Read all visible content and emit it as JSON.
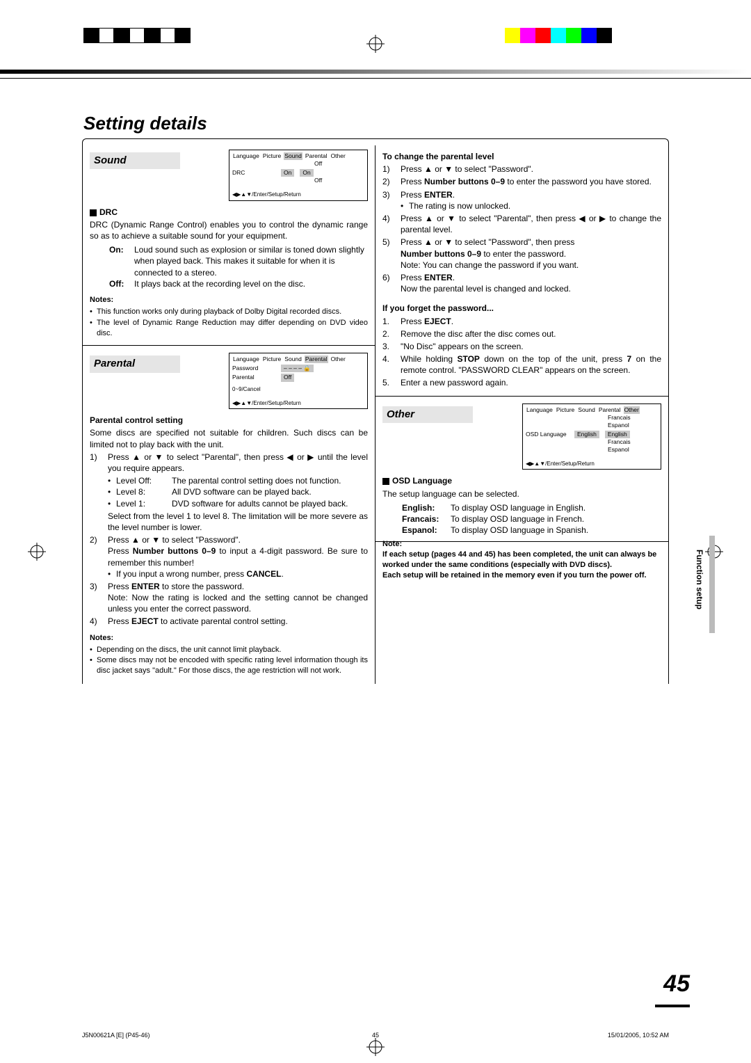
{
  "meta": {
    "page_title": "Setting details",
    "side_label": "Function setup",
    "page_number": "45",
    "footer_left": "J5N00621A [E] (P45-46)",
    "footer_mid": "45",
    "footer_right": "15/01/2005, 10:52 AM"
  },
  "registration": {
    "colorbar_left": [
      "#000000",
      "#ffffff",
      "#000000",
      "#ffffff",
      "#000000",
      "#ffffff",
      "#000000"
    ],
    "colorbar_right": [
      "#ffffff",
      "#ffff00",
      "#ff00ff",
      "#ff0000",
      "#00ffff",
      "#00ff00",
      "#0000ff",
      "#000000"
    ]
  },
  "sound": {
    "heading": "Sound",
    "osd": {
      "tabs": [
        "Language",
        "Picture",
        "Sound",
        "Parental",
        "Other"
      ],
      "selected_tab": "Sound",
      "rows": [
        {
          "label": "DRC",
          "value": "On",
          "options": [
            "On",
            "Off"
          ]
        }
      ],
      "footer": "◀▶▲▼/Enter/Setup/Return"
    },
    "drc_title": "DRC",
    "drc_desc": "DRC (Dynamic Range Control) enables you to control the dynamic range so as to achieve a suitable sound for your equipment.",
    "drc_on": "Loud sound such as explosion or similar is toned down slightly when played back. This makes it suitable for when it is connected to a stereo.",
    "drc_off": "It plays back at the recording level on the disc.",
    "notes_h": "Notes:",
    "notes": [
      "This function works only during playback of Dolby Digital recorded discs.",
      "The level of Dynamic Range Reduction may differ depending on DVD video disc."
    ]
  },
  "parental": {
    "heading": "Parental",
    "osd": {
      "tabs": [
        "Language",
        "Picture",
        "Sound",
        "Parental",
        "Other"
      ],
      "selected_tab": "Parental",
      "rows": [
        {
          "label": "Password",
          "value": "– – – – 🔒"
        },
        {
          "label": "Parental",
          "value": "Off"
        }
      ],
      "hint": "0~9/Cancel",
      "footer": "◀▶▲▼/Enter/Setup/Return"
    },
    "setting_h": "Parental control setting",
    "setting_intro": "Some discs are specified not suitable for children. Such discs can be limited not to play back with the unit.",
    "step1_a": "Press ▲ or ▼ to select \"Parental\", then press ◀ or ▶ until the level you require appears.",
    "levels": [
      {
        "label": "Level Off:",
        "desc": "The parental control setting does not function."
      },
      {
        "label": "Level 8:",
        "desc": "All DVD software can be played back."
      },
      {
        "label": "Level 1:",
        "desc": "DVD software for adults cannot be played back."
      }
    ],
    "step1_b": "Select from the level 1 to level 8. The limitation will be more severe as the level number is lower.",
    "step2_a": "Press ▲ or ▼ to select \"Password\".",
    "step2_b_pre": "Press ",
    "step2_b_bold": "Number buttons 0–9",
    "step2_b_post": " to input a 4-digit password. Be sure to remember this number!",
    "step2_c_pre": "If you input a wrong number, press ",
    "step2_c_bold": "CANCEL",
    "step2_c_post": ".",
    "step3_a_pre": "Press ",
    "step3_a_bold": "ENTER",
    "step3_a_post": " to store the password.",
    "step3_b": "Note: Now the rating is locked and the setting cannot be changed unless you enter the correct password.",
    "step4_pre": "Press ",
    "step4_bold": "EJECT",
    "step4_post": " to activate parental control setting.",
    "notes_h": "Notes:",
    "notes": [
      "Depending on the discs, the unit cannot limit playback.",
      "Some discs may not be encoded with specific rating level information though its disc jacket says \"adult.\" For those discs, the age restriction will not work."
    ]
  },
  "change": {
    "heading": "To change the parental level",
    "s1": "Press ▲ or ▼ to select \"Password\".",
    "s2_pre": "Press ",
    "s2_bold": "Number buttons 0–9",
    "s2_post": " to enter the password you have stored.",
    "s3_pre": "Press ",
    "s3_bold": "ENTER",
    "s3_post": ".",
    "s3_b": "The rating is now unlocked.",
    "s4": "Press ▲ or ▼ to select \"Parental\", then press ◀ or ▶ to change the parental level.",
    "s5_a": "Press ▲ or ▼ to select \"Password\", then press",
    "s5_b_bold": "Number buttons 0–9",
    "s5_b_post": " to enter the password.",
    "s5_c": "Note: You can change the password if you want.",
    "s6_pre": "Press ",
    "s6_bold": "ENTER",
    "s6_post": ".",
    "s6_b": "Now the parental level is changed and locked."
  },
  "forget": {
    "heading": "If you forget the password...",
    "s1_pre": "Press ",
    "s1_bold": "EJECT",
    "s1_post": ".",
    "s2": "Remove the disc after the disc comes out.",
    "s3": "\"No Disc\" appears on the screen.",
    "s4_pre": "While holding ",
    "s4_bold1": "STOP",
    "s4_mid": " down on the top of the unit, press ",
    "s4_bold2": "7",
    "s4_post": " on the remote control. \"PASSWORD CLEAR\" appears on the screen.",
    "s5": "Enter a new password again."
  },
  "other": {
    "heading": "Other",
    "osd": {
      "tabs": [
        "Language",
        "Picture",
        "Sound",
        "Parental",
        "Other"
      ],
      "selected_tab": "Other",
      "rows": [
        {
          "label": "OSD Language",
          "value": "English",
          "options": [
            "English",
            "Francais",
            "Espanol"
          ]
        }
      ],
      "footer": "◀▶▲▼/Enter/Setup/Return"
    },
    "osd_lang_h": "OSD Language",
    "osd_lang_desc": "The setup language can be selected.",
    "langs": [
      {
        "label": "English:",
        "desc": "To display OSD language in English."
      },
      {
        "label": "Francais:",
        "desc": "To display OSD language in French."
      },
      {
        "label": "Espanol:",
        "desc": "To display OSD language in Spanish."
      }
    ]
  },
  "endnote": {
    "lead": "Note:",
    "l1": "If each setup (pages 44 and 45) has been completed, the unit can always be worked under the same conditions (especially with DVD discs).",
    "l2": "Each setup will be retained in the memory even if you turn the power off."
  }
}
